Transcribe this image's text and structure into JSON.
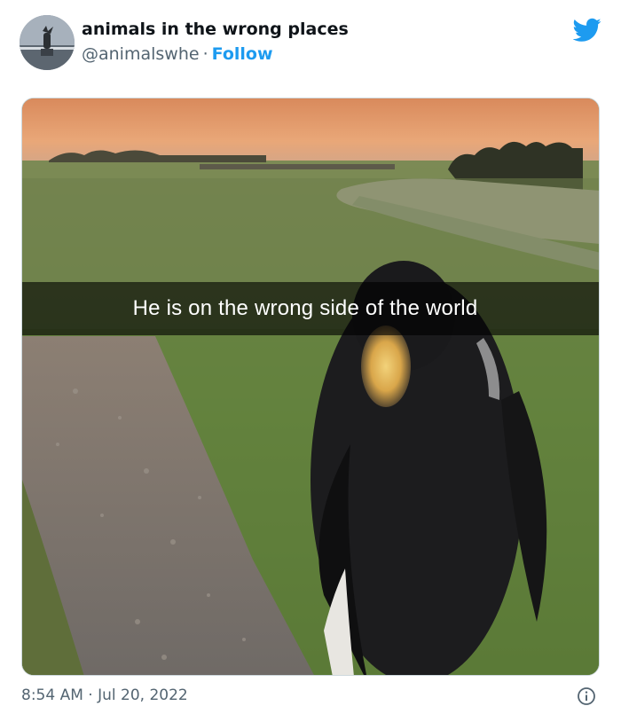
{
  "account": {
    "display_name": "animals in the wrong places",
    "handle": "@animalswhe",
    "separator": "·",
    "follow_label": "Follow",
    "avatar_icon": "avatar-photo-icon"
  },
  "brand": {
    "icon": "twitter-bird-icon",
    "color": "#1d9bf0"
  },
  "media": {
    "caption": "He is on the wrong side of the world",
    "subject": "penguin walking on gravel path at sunset"
  },
  "footer": {
    "timestamp": "8:54 AM · Jul 20, 2022",
    "info_icon": "info-icon"
  },
  "colors": {
    "text_primary": "#0f1419",
    "text_secondary": "#536471",
    "accent": "#1d9bf0"
  }
}
